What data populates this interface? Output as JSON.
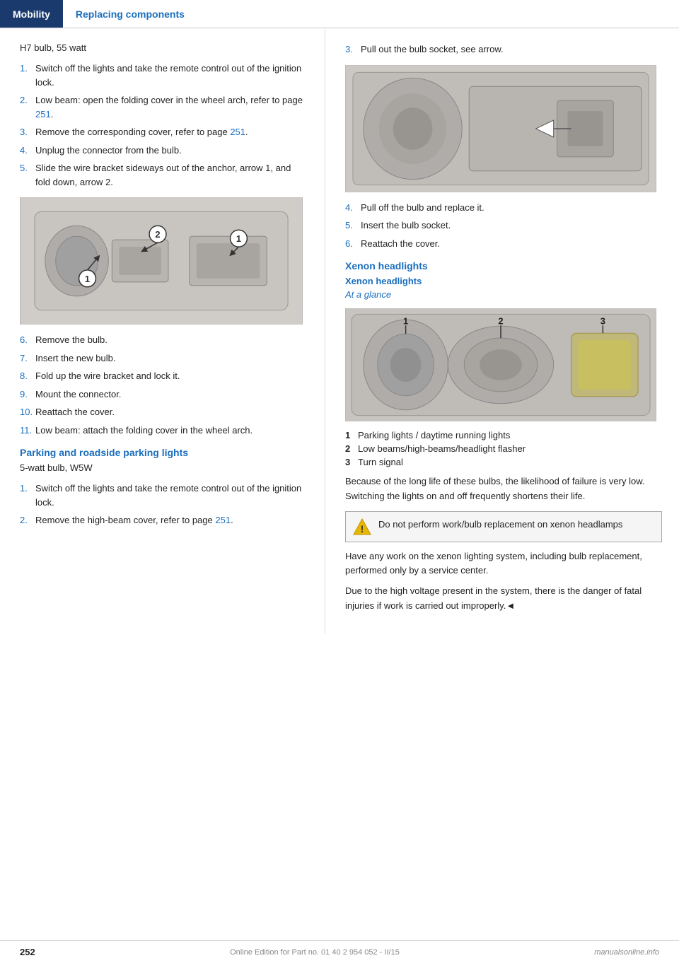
{
  "header": {
    "mobility_label": "Mobility",
    "section_label": "Replacing components"
  },
  "left": {
    "h7_label": "H7 bulb, 55 watt",
    "steps_1": [
      {
        "num": "1.",
        "text": "Switch off the lights and take the remote control out of the ignition lock."
      },
      {
        "num": "2.",
        "text": "Low beam: open the folding cover in the wheel arch, refer to page ",
        "link": "251",
        "link_after": "."
      },
      {
        "num": "3.",
        "text": "Remove the corresponding cover, refer to page ",
        "link": "251",
        "link_after": "."
      },
      {
        "num": "4.",
        "text": "Unplug the connector from the bulb."
      },
      {
        "num": "5.",
        "text": "Slide the wire bracket sideways out of the anchor, arrow 1, and fold down, arrow 2."
      }
    ],
    "steps_2": [
      {
        "num": "6.",
        "text": "Remove the bulb."
      },
      {
        "num": "7.",
        "text": "Insert the new bulb."
      },
      {
        "num": "8.",
        "text": "Fold up the wire bracket and lock it."
      },
      {
        "num": "9.",
        "text": "Mount the connector."
      },
      {
        "num": "10.",
        "text": "Reattach the cover."
      },
      {
        "num": "11.",
        "text": "Low beam: attach the folding cover in the wheel arch."
      }
    ],
    "parking_heading": "Parking and roadside parking lights",
    "parking_bulb": "5-watt bulb, W5W",
    "parking_steps": [
      {
        "num": "1.",
        "text": "Switch off the lights and take the remote control out of the ignition lock."
      },
      {
        "num": "2.",
        "text": "Remove the high-beam cover, refer to page ",
        "link": "251",
        "link_after": "."
      }
    ]
  },
  "right": {
    "step3_text": "Pull out the bulb socket, see arrow.",
    "steps_r": [
      {
        "num": "4.",
        "text": "Pull off the bulb and replace it."
      },
      {
        "num": "5.",
        "text": "Insert the bulb socket."
      },
      {
        "num": "6.",
        "text": "Reattach the cover."
      }
    ],
    "xenon_heading": "Xenon headlights",
    "xenon_sub": "Xenon headlights",
    "at_glance": "At a glance",
    "glance_items": [
      {
        "num": "1",
        "text": "Parking lights / daytime running lights"
      },
      {
        "num": "2",
        "text": "Low beams/high-beams/headlight flasher"
      },
      {
        "num": "3",
        "text": "Turn signal"
      }
    ],
    "body1": "Because of the long life of these bulbs, the likelihood of failure is very low. Switching the lights on and off frequently shortens their life.",
    "warning_text": "Do not perform work/bulb replacement on xenon headlamps",
    "body2": "Have any work on the xenon lighting system, including bulb replacement, performed only by a service center.",
    "body3": "Due to the high voltage present in the system, there is the danger of fatal injuries if work is carried out improperly.◄"
  },
  "footer": {
    "page": "252",
    "info": "Online Edition for Part no. 01 40 2 954 052 - II/15",
    "brand": "manualsonline.info"
  }
}
